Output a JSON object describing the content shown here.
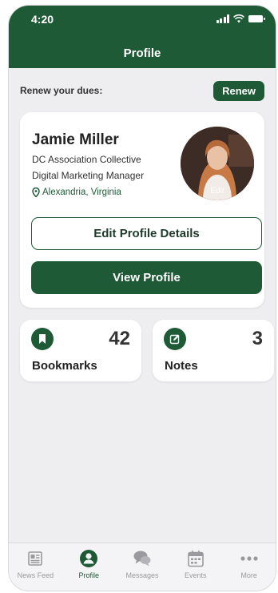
{
  "status_bar": {
    "time": "4:20"
  },
  "header": {
    "title": "Profile"
  },
  "dues": {
    "text": "Renew your dues:",
    "button_label": "Renew"
  },
  "profile": {
    "name": "Jamie Miller",
    "organization": "DC Association Collective",
    "job_title": "Digital Marketing Manager",
    "location": "Alexandria, Virginia",
    "avatar_edit_label": "Edit",
    "edit_button_label": "Edit Profile Details",
    "view_button_label": "View Profile"
  },
  "stats": [
    {
      "label": "Bookmarks",
      "count": "42",
      "icon": "bookmark-icon"
    },
    {
      "label": "Notes",
      "count": "3",
      "icon": "edit-note-icon"
    }
  ],
  "tabbar": {
    "items": [
      {
        "label": "News Feed",
        "icon": "newspaper-icon"
      },
      {
        "label": "Profile",
        "icon": "person-icon"
      },
      {
        "label": "Messages",
        "icon": "chat-bubbles-icon"
      },
      {
        "label": "Events",
        "icon": "calendar-icon"
      },
      {
        "label": "More",
        "icon": "more-dots-icon"
      }
    ],
    "active": "Profile"
  },
  "colors": {
    "brand": "#1e5a36",
    "background": "#eeeef1",
    "inactive": "#9a9a9e"
  }
}
